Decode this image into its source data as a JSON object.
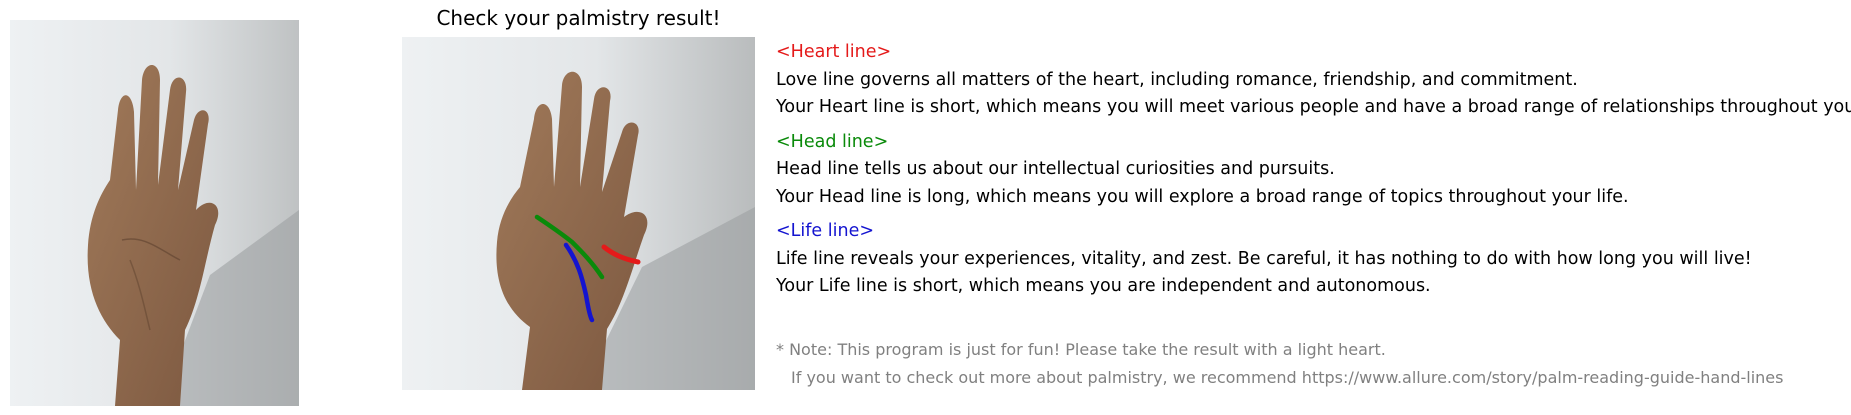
{
  "result_title": "Check your palmistry result!",
  "colors": {
    "heart": "#e41a1a",
    "head": "#0a8a0a",
    "life": "#1414d0",
    "note": "#808080"
  },
  "sections": [
    {
      "key": "heart",
      "header": "<Heart line>",
      "lines": [
        "Love line governs all matters of the heart, including romance, friendship, and commitment.",
        "Your Heart line is short, which means you will meet various people and have a broad range of relationships throughout your life."
      ]
    },
    {
      "key": "head",
      "header": "<Head line>",
      "lines": [
        "Head line tells us about our intellectual curiosities and pursuits.",
        "Your Head line is long, which means you will explore a broad range of topics throughout your life."
      ]
    },
    {
      "key": "life",
      "header": "<Life line>",
      "lines": [
        "Life line reveals your experiences, vitality, and zest. Be careful, it has nothing to do with how long you will live!",
        "Your Life line is short, which means you are independent and autonomous."
      ]
    }
  ],
  "note": {
    "line1": "* Note: This program is just for fun! Please take the result with a light heart.",
    "line2": "If you want to check out more about palmistry, we recommend https://www.allure.com/story/palm-reading-guide-hand-lines"
  }
}
